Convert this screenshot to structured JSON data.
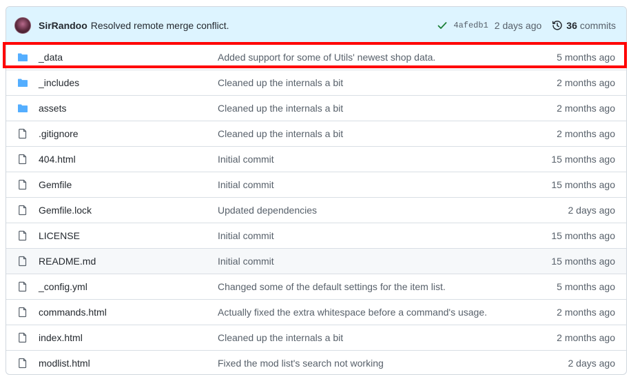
{
  "latest_commit": {
    "author": "SirRandoo",
    "message": "Resolved remote merge conflict.",
    "sha": "4afedb1",
    "time": "2 days ago",
    "commit_count": "36",
    "commits_label": "commits"
  },
  "colors": {
    "folder": "#54aeff",
    "file": "#57606a",
    "check": "#1a7f37",
    "highlight": "#ff0000"
  },
  "files": [
    {
      "type": "folder",
      "name": "_data",
      "message": "Added support for some of Utils' newest shop data.",
      "time": "5 months ago"
    },
    {
      "type": "folder",
      "name": "_includes",
      "message": "Cleaned up the internals a bit",
      "time": "2 months ago"
    },
    {
      "type": "folder",
      "name": "assets",
      "message": "Cleaned up the internals a bit",
      "time": "2 months ago"
    },
    {
      "type": "file",
      "name": ".gitignore",
      "message": "Cleaned up the internals a bit",
      "time": "2 months ago"
    },
    {
      "type": "file",
      "name": "404.html",
      "message": "Initial commit",
      "time": "15 months ago"
    },
    {
      "type": "file",
      "name": "Gemfile",
      "message": "Initial commit",
      "time": "15 months ago"
    },
    {
      "type": "file",
      "name": "Gemfile.lock",
      "message": "Updated dependencies",
      "time": "2 days ago"
    },
    {
      "type": "file",
      "name": "LICENSE",
      "message": "Initial commit",
      "time": "15 months ago"
    },
    {
      "type": "file",
      "name": "README.md",
      "message": "Initial commit",
      "time": "15 months ago"
    },
    {
      "type": "file",
      "name": "_config.yml",
      "message": "Changed some of the default settings for the item list.",
      "time": "5 months ago"
    },
    {
      "type": "file",
      "name": "commands.html",
      "message": "Actually fixed the extra whitespace before a command's usage.",
      "time": "2 months ago"
    },
    {
      "type": "file",
      "name": "index.html",
      "message": "Cleaned up the internals a bit",
      "time": "2 months ago"
    },
    {
      "type": "file",
      "name": "modlist.html",
      "message": "Fixed the mod list's search not working",
      "time": "2 days ago"
    }
  ]
}
